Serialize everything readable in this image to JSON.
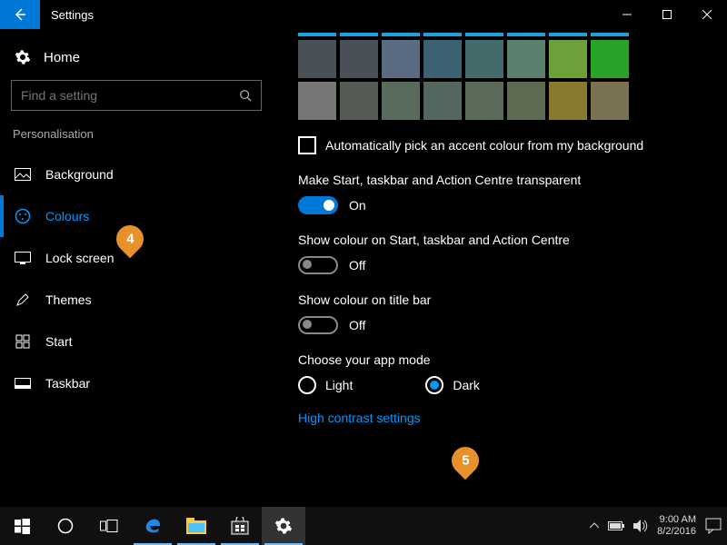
{
  "window": {
    "title": "Settings"
  },
  "sidebar": {
    "home": "Home",
    "search_placeholder": "Find a setting",
    "section": "Personalisation",
    "items": [
      {
        "label": "Background"
      },
      {
        "label": "Colours"
      },
      {
        "label": "Lock screen"
      },
      {
        "label": "Themes"
      },
      {
        "label": "Start"
      },
      {
        "label": "Taskbar"
      }
    ]
  },
  "main": {
    "swatches_row1": [
      "#4a5057",
      "#4a5057",
      "#5a6b82",
      "#3b6172",
      "#436b6b",
      "#5c806e",
      "#6ea03a",
      "#28a428"
    ],
    "swatches_row2": [
      "#767676",
      "#565b56",
      "#596b5c",
      "#54675f",
      "#5a6b5a",
      "#5f6a52",
      "#887a2e",
      "#7a7252"
    ],
    "auto_pick": "Automatically pick an accent colour from my background",
    "transparent": {
      "label": "Make Start, taskbar and Action Centre transparent",
      "state": "On"
    },
    "show_start": {
      "label": "Show colour on Start, taskbar and Action Centre",
      "state": "Off"
    },
    "show_title": {
      "label": "Show colour on title bar",
      "state": "Off"
    },
    "app_mode": {
      "label": "Choose your app mode",
      "light": "Light",
      "dark": "Dark"
    },
    "link": "High contrast settings"
  },
  "callouts": {
    "c4": "4",
    "c5": "5"
  },
  "taskbar": {
    "time": "9:00 AM",
    "date": "8/2/2016"
  }
}
